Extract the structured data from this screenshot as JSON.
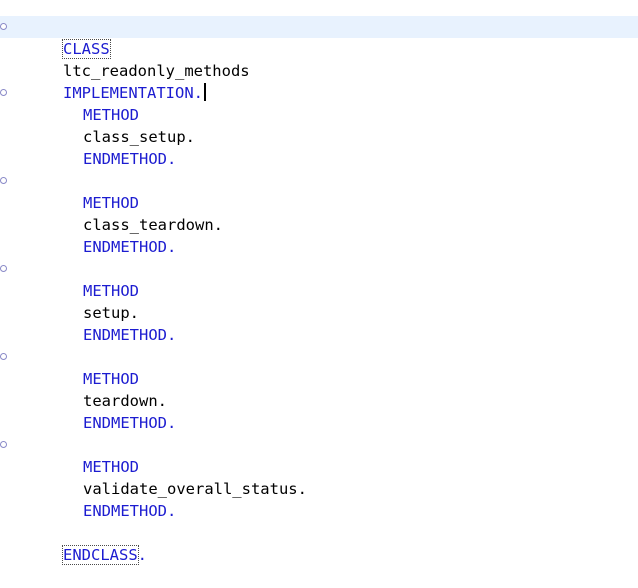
{
  "editor": {
    "colors": {
      "keyword": "#1c1cd0",
      "identifier": "#000000",
      "current_line_bg": "#e8f2fe"
    },
    "lines": {
      "class_decl": {
        "kw1": "CLASS",
        "name": "ltc_readonly_methods",
        "kw2": "IMPLEMENTATION",
        "dot": "."
      },
      "m1": {
        "kw": "METHOD",
        "name": "class_setup",
        "dot": "."
      },
      "e1": {
        "kw": "ENDMETHOD",
        "dot": "."
      },
      "m2": {
        "kw": "METHOD",
        "name": "class_teardown",
        "dot": "."
      },
      "e2": {
        "kw": "ENDMETHOD",
        "dot": "."
      },
      "m3": {
        "kw": "METHOD",
        "name": "setup",
        "dot": "."
      },
      "e3": {
        "kw": "ENDMETHOD",
        "dot": "."
      },
      "m4": {
        "kw": "METHOD",
        "name": "teardown",
        "dot": "."
      },
      "e4": {
        "kw": "ENDMETHOD",
        "dot": "."
      },
      "m5": {
        "kw": "METHOD",
        "name": "validate_overall_status",
        "dot": "."
      },
      "e5": {
        "kw": "ENDMETHOD",
        "dot": "."
      },
      "endclass": {
        "kw": "ENDCLASS",
        "dot": "."
      }
    }
  }
}
